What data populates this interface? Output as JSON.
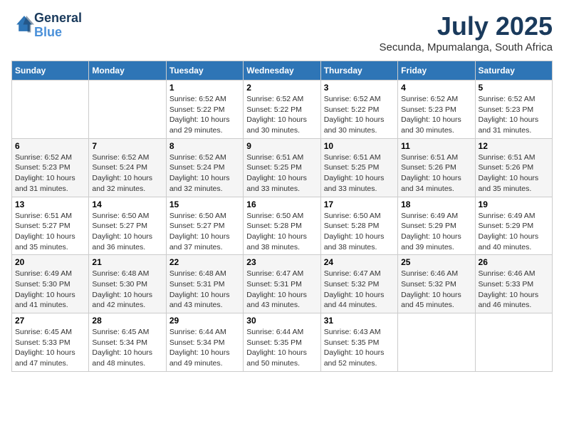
{
  "logo": {
    "line1": "General",
    "line2": "Blue"
  },
  "title": "July 2025",
  "location": "Secunda, Mpumalanga, South Africa",
  "days_of_week": [
    "Sunday",
    "Monday",
    "Tuesday",
    "Wednesday",
    "Thursday",
    "Friday",
    "Saturday"
  ],
  "weeks": [
    [
      {
        "day": "",
        "sunrise": "",
        "sunset": "",
        "daylight": ""
      },
      {
        "day": "",
        "sunrise": "",
        "sunset": "",
        "daylight": ""
      },
      {
        "day": "1",
        "sunrise": "Sunrise: 6:52 AM",
        "sunset": "Sunset: 5:22 PM",
        "daylight": "Daylight: 10 hours and 29 minutes."
      },
      {
        "day": "2",
        "sunrise": "Sunrise: 6:52 AM",
        "sunset": "Sunset: 5:22 PM",
        "daylight": "Daylight: 10 hours and 30 minutes."
      },
      {
        "day": "3",
        "sunrise": "Sunrise: 6:52 AM",
        "sunset": "Sunset: 5:22 PM",
        "daylight": "Daylight: 10 hours and 30 minutes."
      },
      {
        "day": "4",
        "sunrise": "Sunrise: 6:52 AM",
        "sunset": "Sunset: 5:23 PM",
        "daylight": "Daylight: 10 hours and 30 minutes."
      },
      {
        "day": "5",
        "sunrise": "Sunrise: 6:52 AM",
        "sunset": "Sunset: 5:23 PM",
        "daylight": "Daylight: 10 hours and 31 minutes."
      }
    ],
    [
      {
        "day": "6",
        "sunrise": "Sunrise: 6:52 AM",
        "sunset": "Sunset: 5:23 PM",
        "daylight": "Daylight: 10 hours and 31 minutes."
      },
      {
        "day": "7",
        "sunrise": "Sunrise: 6:52 AM",
        "sunset": "Sunset: 5:24 PM",
        "daylight": "Daylight: 10 hours and 32 minutes."
      },
      {
        "day": "8",
        "sunrise": "Sunrise: 6:52 AM",
        "sunset": "Sunset: 5:24 PM",
        "daylight": "Daylight: 10 hours and 32 minutes."
      },
      {
        "day": "9",
        "sunrise": "Sunrise: 6:51 AM",
        "sunset": "Sunset: 5:25 PM",
        "daylight": "Daylight: 10 hours and 33 minutes."
      },
      {
        "day": "10",
        "sunrise": "Sunrise: 6:51 AM",
        "sunset": "Sunset: 5:25 PM",
        "daylight": "Daylight: 10 hours and 33 minutes."
      },
      {
        "day": "11",
        "sunrise": "Sunrise: 6:51 AM",
        "sunset": "Sunset: 5:26 PM",
        "daylight": "Daylight: 10 hours and 34 minutes."
      },
      {
        "day": "12",
        "sunrise": "Sunrise: 6:51 AM",
        "sunset": "Sunset: 5:26 PM",
        "daylight": "Daylight: 10 hours and 35 minutes."
      }
    ],
    [
      {
        "day": "13",
        "sunrise": "Sunrise: 6:51 AM",
        "sunset": "Sunset: 5:27 PM",
        "daylight": "Daylight: 10 hours and 35 minutes."
      },
      {
        "day": "14",
        "sunrise": "Sunrise: 6:50 AM",
        "sunset": "Sunset: 5:27 PM",
        "daylight": "Daylight: 10 hours and 36 minutes."
      },
      {
        "day": "15",
        "sunrise": "Sunrise: 6:50 AM",
        "sunset": "Sunset: 5:27 PM",
        "daylight": "Daylight: 10 hours and 37 minutes."
      },
      {
        "day": "16",
        "sunrise": "Sunrise: 6:50 AM",
        "sunset": "Sunset: 5:28 PM",
        "daylight": "Daylight: 10 hours and 38 minutes."
      },
      {
        "day": "17",
        "sunrise": "Sunrise: 6:50 AM",
        "sunset": "Sunset: 5:28 PM",
        "daylight": "Daylight: 10 hours and 38 minutes."
      },
      {
        "day": "18",
        "sunrise": "Sunrise: 6:49 AM",
        "sunset": "Sunset: 5:29 PM",
        "daylight": "Daylight: 10 hours and 39 minutes."
      },
      {
        "day": "19",
        "sunrise": "Sunrise: 6:49 AM",
        "sunset": "Sunset: 5:29 PM",
        "daylight": "Daylight: 10 hours and 40 minutes."
      }
    ],
    [
      {
        "day": "20",
        "sunrise": "Sunrise: 6:49 AM",
        "sunset": "Sunset: 5:30 PM",
        "daylight": "Daylight: 10 hours and 41 minutes."
      },
      {
        "day": "21",
        "sunrise": "Sunrise: 6:48 AM",
        "sunset": "Sunset: 5:30 PM",
        "daylight": "Daylight: 10 hours and 42 minutes."
      },
      {
        "day": "22",
        "sunrise": "Sunrise: 6:48 AM",
        "sunset": "Sunset: 5:31 PM",
        "daylight": "Daylight: 10 hours and 43 minutes."
      },
      {
        "day": "23",
        "sunrise": "Sunrise: 6:47 AM",
        "sunset": "Sunset: 5:31 PM",
        "daylight": "Daylight: 10 hours and 43 minutes."
      },
      {
        "day": "24",
        "sunrise": "Sunrise: 6:47 AM",
        "sunset": "Sunset: 5:32 PM",
        "daylight": "Daylight: 10 hours and 44 minutes."
      },
      {
        "day": "25",
        "sunrise": "Sunrise: 6:46 AM",
        "sunset": "Sunset: 5:32 PM",
        "daylight": "Daylight: 10 hours and 45 minutes."
      },
      {
        "day": "26",
        "sunrise": "Sunrise: 6:46 AM",
        "sunset": "Sunset: 5:33 PM",
        "daylight": "Daylight: 10 hours and 46 minutes."
      }
    ],
    [
      {
        "day": "27",
        "sunrise": "Sunrise: 6:45 AM",
        "sunset": "Sunset: 5:33 PM",
        "daylight": "Daylight: 10 hours and 47 minutes."
      },
      {
        "day": "28",
        "sunrise": "Sunrise: 6:45 AM",
        "sunset": "Sunset: 5:34 PM",
        "daylight": "Daylight: 10 hours and 48 minutes."
      },
      {
        "day": "29",
        "sunrise": "Sunrise: 6:44 AM",
        "sunset": "Sunset: 5:34 PM",
        "daylight": "Daylight: 10 hours and 49 minutes."
      },
      {
        "day": "30",
        "sunrise": "Sunrise: 6:44 AM",
        "sunset": "Sunset: 5:35 PM",
        "daylight": "Daylight: 10 hours and 50 minutes."
      },
      {
        "day": "31",
        "sunrise": "Sunrise: 6:43 AM",
        "sunset": "Sunset: 5:35 PM",
        "daylight": "Daylight: 10 hours and 52 minutes."
      },
      {
        "day": "",
        "sunrise": "",
        "sunset": "",
        "daylight": ""
      },
      {
        "day": "",
        "sunrise": "",
        "sunset": "",
        "daylight": ""
      }
    ]
  ]
}
